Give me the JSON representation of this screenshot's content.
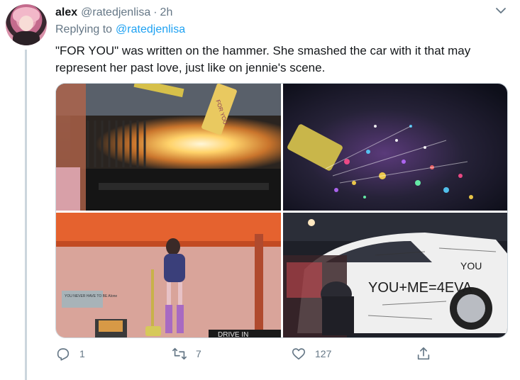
{
  "tweet": {
    "author_name": "alex",
    "author_handle": "@ratedjenlisa",
    "separator": "·",
    "timestamp": "2h",
    "replying_to_label": "Replying to",
    "replying_to_handle": "@ratedjenlisa",
    "text": "\"FOR YOU\" was written on the hammer. She smashed the car with it that may represent her past love, just like on jennie's scene.",
    "media": {
      "photo_1_sign_text": "FOR YOU",
      "photo_3_sign_text": "YOU NEVER HAVE TO BE Alone",
      "photo_3_drive_in_text": "DRIVE IN",
      "photo_4_car_text_1": "YOU+ME=4EVA",
      "photo_4_car_text_2": "YOU"
    },
    "actions": {
      "reply_count": "1",
      "retweet_count": "7",
      "like_count": "127"
    }
  },
  "colors": {
    "link": "#1da1f2",
    "secondary_text": "#657786",
    "primary_text": "#14171a",
    "thread_line": "#ccd6dd"
  },
  "icons": {
    "caret": "chevron-down-icon",
    "reply": "reply-icon",
    "retweet": "retweet-icon",
    "like": "heart-icon",
    "share": "share-icon"
  }
}
